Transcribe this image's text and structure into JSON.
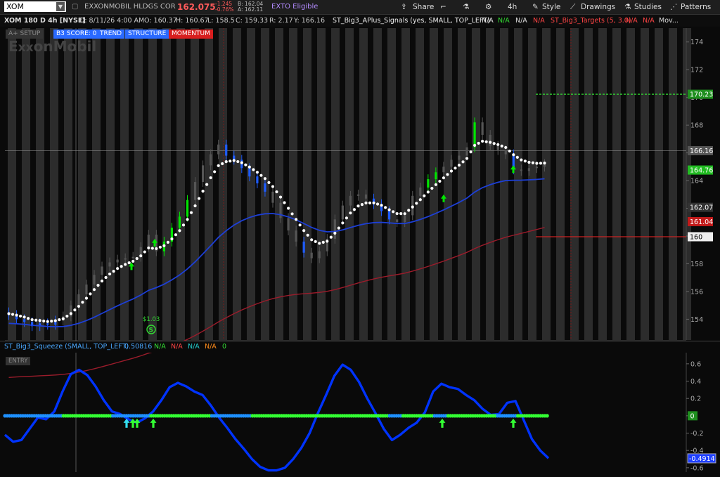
{
  "toolbar": {
    "symbol": "XOM",
    "company": "EXXONMOBIL HLDGS COR",
    "last": "162.075",
    "change": "-1.245",
    "change_pct": "-0.76%",
    "bid": "B: 162.04",
    "ask": "A: 162.11",
    "badge": "EXTO Eligible",
    "share": "Share",
    "timeframe": "4h",
    "style": "Style",
    "drawings": "Drawings",
    "studies": "Studies",
    "patterns": "Patterns"
  },
  "info": {
    "title": "XOM 180 D 4h [NYSE]",
    "date": "D: 8/11/26 4:00 AM",
    "open": "O: 160.37",
    "high": "H: 160.67",
    "low": "L: 158.5",
    "close": "C: 159.33",
    "range": "R: 2.17",
    "y": "Y: 166.16",
    "study1": "ST_Big3_APlus_Signals (yes, SMALL, TOP_LEFT)",
    "na": "N/A",
    "study2": "ST_Big3_Targets (5, 3.0)",
    "more": "Mov..."
  },
  "tags": {
    "setup": "A+ SETUP",
    "score": "B3 SCORE: 0",
    "trend": "TREND",
    "structure": "STRUCTURE",
    "momentum": "MOMENTUM"
  },
  "lower_header": {
    "study": "ST_Big3_Squeeze (SMALL, TOP_LEFT)",
    "value": "0.50816",
    "na": "N/A",
    "zero": "0",
    "entry": "ENTRY"
  },
  "colors": {
    "up": "#00e600",
    "down": "#1e5cff",
    "neutral": "#555555",
    "ema": "#1d3fd6",
    "sma": "#9b1c2b",
    "dots": "#ffffff",
    "target_up": "#33dd33",
    "target_down": "#cc2222",
    "momentum": "#0033ff",
    "squeeze_on": "#1e90ff",
    "squeeze_off": "#33ff33"
  },
  "chart_data": [
    {
      "type": "line",
      "ylim": [
        152.5,
        175
      ],
      "yticks": [
        154,
        156,
        158,
        160,
        162,
        164,
        166,
        168,
        170,
        172,
        174
      ],
      "candle_closes": [
        154.3,
        154.0,
        153.8,
        153.5,
        153.7,
        153.6,
        153.9,
        154.2,
        155.0,
        155.8,
        156.5,
        157.2,
        157.8,
        158.1,
        158.3,
        158.4,
        158.5,
        159.2,
        160.1,
        158.9,
        159.6,
        160.6,
        161.4,
        162.6,
        163.9,
        165.1,
        165.9,
        166.6,
        165.8,
        165.5,
        164.9,
        164.3,
        163.8,
        163.2,
        162.4,
        161.3,
        160.4,
        159.6,
        158.8,
        158.4,
        158.9,
        159.8,
        161.2,
        162.2,
        162.9,
        163.0,
        162.7,
        162.3,
        161.8,
        161.2,
        161.0,
        161.5,
        162.9,
        163.5,
        164.1,
        164.6,
        165.0,
        165.5,
        165.8,
        166.4,
        168.2,
        167.3,
        166.5,
        166.2,
        165.9,
        164.8,
        164.7,
        164.9,
        165.0,
        165.2
      ],
      "labels": {
        "price_high": "166.16",
        "ema_value": "164.76",
        "last_price": "162.07",
        "sma_value": "161.04",
        "target_up": "170.23",
        "target_down": "160",
        "dividend": "$1.03"
      },
      "target_up_value": 170.23,
      "target_down_value": 159.95,
      "crosshair_y": 166.16
    },
    {
      "type": "line",
      "ylim": [
        -0.65,
        0.68
      ],
      "yticks": [
        0.6,
        0.4,
        0.2,
        0,
        -0.2,
        -0.4,
        -0.6
      ],
      "last_value": "-0.4914",
      "zero_label": "0",
      "momentum": [
        -0.22,
        -0.3,
        -0.28,
        -0.15,
        -0.02,
        -0.04,
        0.05,
        0.28,
        0.48,
        0.53,
        0.47,
        0.34,
        0.18,
        0.05,
        0.02,
        -0.04,
        -0.08,
        -0.03,
        0.05,
        0.18,
        0.33,
        0.38,
        0.34,
        0.28,
        0.24,
        0.12,
        -0.02,
        -0.14,
        -0.27,
        -0.38,
        -0.5,
        -0.59,
        -0.63,
        -0.63,
        -0.6,
        -0.5,
        -0.37,
        -0.2,
        0.03,
        0.24,
        0.46,
        0.59,
        0.53,
        0.39,
        0.2,
        0.03,
        -0.15,
        -0.28,
        -0.22,
        -0.14,
        -0.08,
        0.04,
        0.28,
        0.37,
        0.33,
        0.31,
        0.24,
        0.18,
        0.08,
        0.01,
        0.02,
        0.15,
        0.17,
        -0.05,
        -0.27,
        -0.4,
        -0.49
      ]
    }
  ]
}
